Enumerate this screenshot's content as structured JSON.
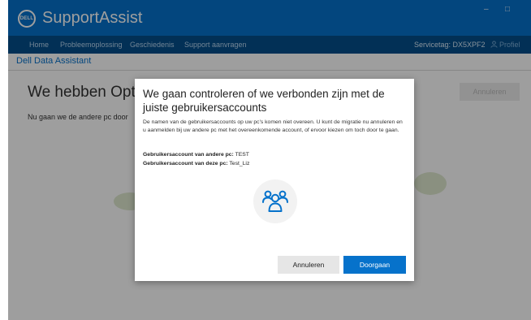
{
  "app": {
    "title": "SupportAssist",
    "logo_text": "DELL"
  },
  "window_controls": {
    "minimize": "–",
    "maximize": "□"
  },
  "nav": {
    "items": [
      {
        "label": "Home"
      },
      {
        "label": "Probleemoplossing"
      },
      {
        "label": "Geschiedenis"
      },
      {
        "label": "Support aanvragen"
      }
    ],
    "service_tag": "Servicetag: DX5XPF2",
    "profile": "Profiel"
  },
  "subheader": {
    "title": "Dell Data Assistant"
  },
  "background": {
    "heading": "We hebben OptiPle",
    "text": "Nu gaan we de andere pc door",
    "cancel_label": "Annuleren"
  },
  "dialog": {
    "title": "We gaan controleren of we verbonden zijn met de juiste gebruikersaccounts",
    "body": "De namen van de gebruikersaccounts op uw pc's komen niet overeen. U kunt de migratie nu annuleren en u aanmelden bij uw andere pc met het overeenkomende account, of ervoor kiezen om toch door te gaan.",
    "other_pc_label": "Gebruikersaccount van andere pc:",
    "other_pc_value": "TEST",
    "this_pc_label": "Gebruikersaccount van deze pc:",
    "this_pc_value": "Test_Liz",
    "icon": "users-icon",
    "cancel_label": "Annuleren",
    "continue_label": "Doorgaan"
  },
  "colors": {
    "brand": "#0672cb",
    "nav": "#044e8c"
  }
}
